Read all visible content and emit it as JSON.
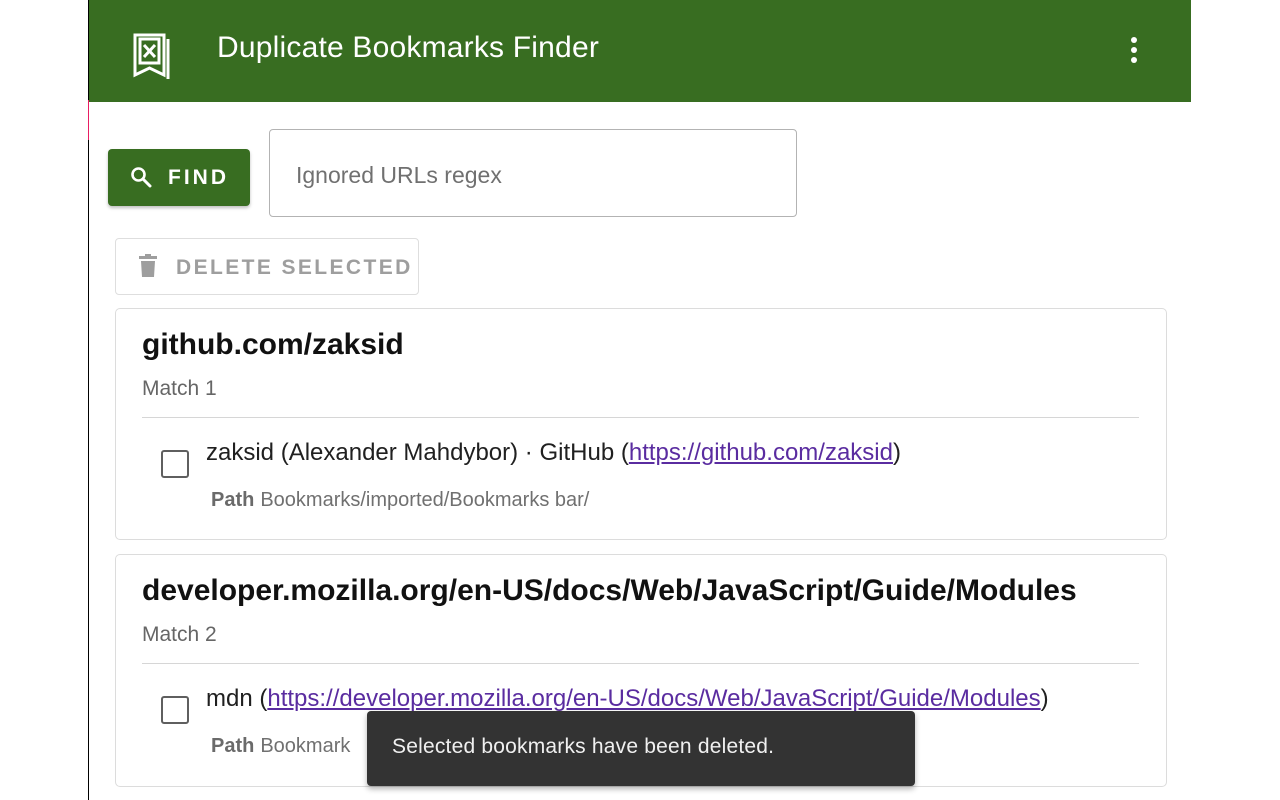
{
  "header": {
    "title": "Duplicate Bookmarks Finder",
    "logo_icon": "bookmark-x-icon",
    "menu_icon": "more-vert-icon",
    "color": "#386d21"
  },
  "toolbar": {
    "find_label": "FIND",
    "find_icon": "search-icon",
    "regex_placeholder": "Ignored URLs regex",
    "regex_value": "",
    "delete_label": "DELETE SELECTED",
    "delete_icon": "trash-icon"
  },
  "groups": [
    {
      "title": "github.com/zaksid",
      "subtitle": "Match 1",
      "bookmarks": [
        {
          "name": "zaksid (Alexander Mahdybor) · GitHub",
          "url": "https://github.com/zaksid",
          "path_label": "Path",
          "path": "Bookmarks/imported/Bookmarks bar/",
          "checked": false
        }
      ]
    },
    {
      "title": "developer.mozilla.org/en-US/docs/Web/JavaScript/Guide/Modules",
      "subtitle": "Match 2",
      "bookmarks": [
        {
          "name": "mdn",
          "url": "https://developer.mozilla.org/en-US/docs/Web/JavaScript/Guide/Modules",
          "path_label": "Path",
          "path": "Bookmark",
          "checked": false
        }
      ]
    }
  ],
  "snackbar": {
    "message": "Selected bookmarks have been deleted."
  },
  "punct": {
    "open_paren": " (",
    "close_paren": ")"
  }
}
